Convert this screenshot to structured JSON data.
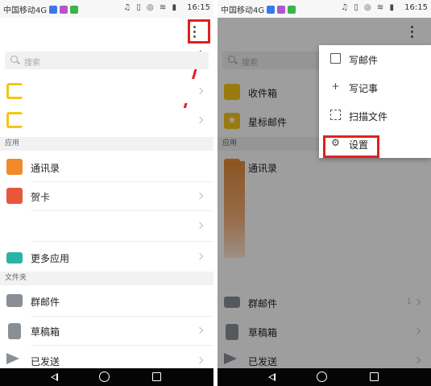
{
  "status_bar": {
    "carrier": "中国移动4G",
    "time": "16:15",
    "sys_icons": "♫ ▯ ◎ ≋ ▮"
  },
  "left": {
    "search_placeholder": "搜索",
    "accounts": [
      {
        "label": ""
      },
      {
        "label": ""
      }
    ],
    "section_apps": "应用",
    "apps": [
      {
        "label": "通讯录"
      },
      {
        "label": "贺卡"
      },
      {
        "label": ""
      },
      {
        "label": "更多应用"
      }
    ],
    "section_folders": "文件夹",
    "folders": [
      {
        "label": "群邮件"
      },
      {
        "label": "草稿箱"
      },
      {
        "label": "已发送"
      }
    ]
  },
  "right": {
    "search_placeholder": "搜索",
    "folders_top": [
      {
        "label": "收件箱"
      },
      {
        "label": "星标邮件"
      }
    ],
    "section_apps": "应用",
    "apps": [
      {
        "label": "通讯录"
      }
    ],
    "folders": [
      {
        "label": "群邮件",
        "count": "1"
      },
      {
        "label": "草稿箱"
      },
      {
        "label": "已发送"
      }
    ],
    "menu": [
      {
        "label": "写邮件",
        "icon": "compose-icon"
      },
      {
        "label": "写记事",
        "icon": "plus-icon"
      },
      {
        "label": "扫描文件",
        "icon": "scan-icon"
      },
      {
        "label": "设置",
        "icon": "gear-icon"
      }
    ]
  },
  "colors": {
    "highlight": "#e02020",
    "accent_yellow": "#f5c518",
    "accent_orange": "#f08a2c"
  }
}
